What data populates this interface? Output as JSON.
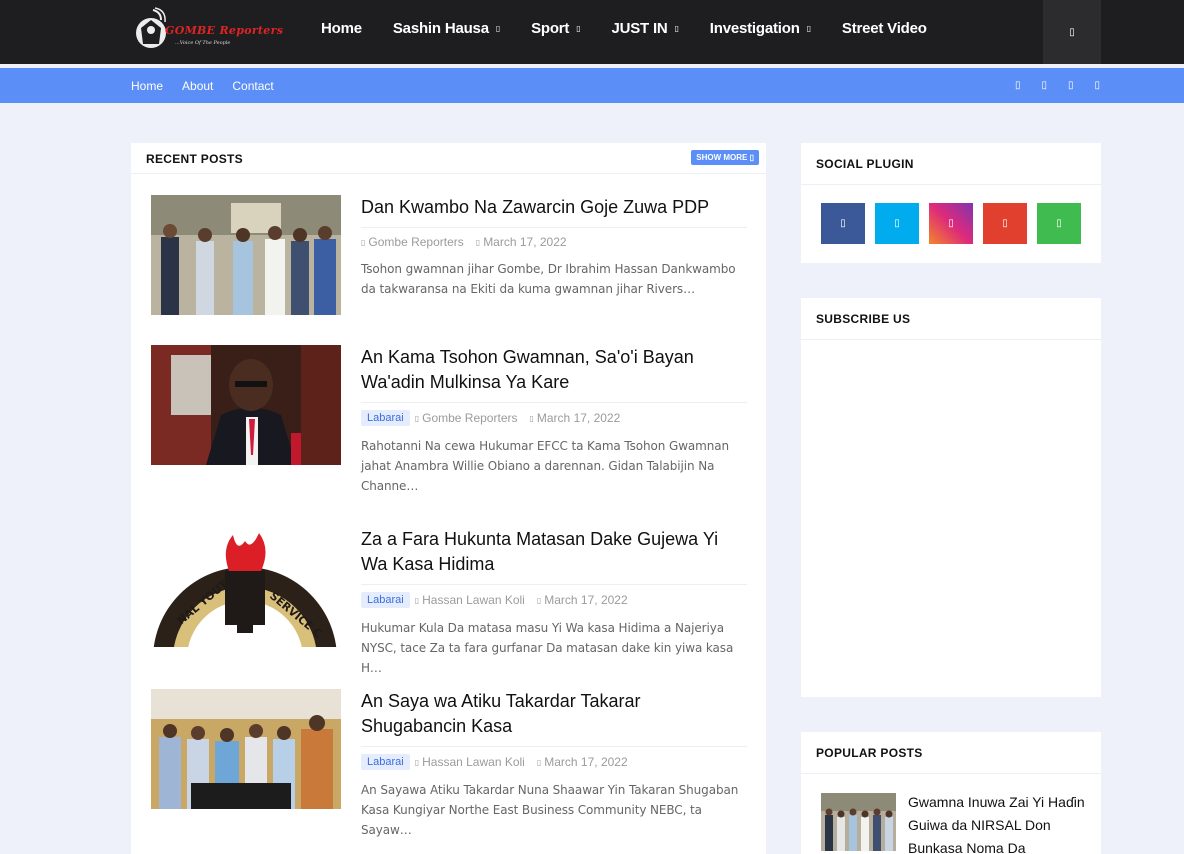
{
  "header": {
    "logo_text": "GOMBE Reporters",
    "logo_tagline": "...Voice Of The People",
    "nav": [
      {
        "label": "Home",
        "has_dropdown": false
      },
      {
        "label": "Sashin Hausa",
        "has_dropdown": true
      },
      {
        "label": "Sport",
        "has_dropdown": true
      },
      {
        "label": "JUST IN",
        "has_dropdown": true
      },
      {
        "label": "Investigation",
        "has_dropdown": true
      },
      {
        "label": "Street Video",
        "has_dropdown": false
      }
    ],
    "search_icon": "search-icon"
  },
  "subnav": {
    "links": [
      "Home",
      "About",
      "Contact"
    ],
    "social_icons": [
      "facebook-icon",
      "twitter-icon",
      "instagram-icon",
      "youtube-icon"
    ]
  },
  "recent_posts": {
    "title": "RECENT POSTS",
    "show_more": "SHOW MORE",
    "posts": [
      {
        "title": "Dan Kwambo Na Zawarcin Goje Zuwa PDP",
        "tag": "",
        "author": "Gombe Reporters",
        "date": "March 17, 2022",
        "excerpt": "Tsohon gwamnan jihar Gombe, Dr Ibrahim Hassan Dankwambo da takwaransa na Ekiti da kuma gwamnan jihar Rivers…"
      },
      {
        "title": "An Kama Tsohon Gwamnan, Sa'o'i Bayan Wa'adin Mulkinsa Ya Kare",
        "tag": "Labarai",
        "author": "Gombe Reporters",
        "date": "March 17, 2022",
        "excerpt": "Rahotanni Na cewa Hukumar EFCC ta Kama Tsohon Gwamnan jahat Anambra Willie Obiano a darennan. Gidan Talabijin Na Channe…"
      },
      {
        "title": "Za a Fara Hukunta Matasan Dake Gujewa Yi Wa Kasa Hidima",
        "tag": "Labarai",
        "author": "Hassan Lawan Koli",
        "date": "March 17, 2022",
        "excerpt": "Hukumar Kula Da matasa masu Yi Wa kasa Hidima a Najeriya NYSC, tace Za ta fara gurfanar Da matasan dake kin yiwa kasa H…"
      },
      {
        "title": "An Saya wa Atiku Takardar Takarar Shugabancin Kasa",
        "tag": "Labarai",
        "author": "Hassan Lawan Koli",
        "date": "March 17, 2022",
        "excerpt": "An Sayawa Atiku Takardar Nuna Shaawar Yin Takaran Shugaban Kasa Kungiyar Northe East Business Community NEBC, ta Sayaw…"
      }
    ]
  },
  "sidebar": {
    "social_plugin": {
      "title": "SOCIAL PLUGIN",
      "buttons": [
        {
          "icon": "facebook-icon",
          "color": "#3b5998"
        },
        {
          "icon": "twitter-icon",
          "color": "#00acee"
        },
        {
          "icon": "instagram-icon",
          "color": "#c13584"
        },
        {
          "icon": "youtube-icon",
          "color": "#e2402f"
        },
        {
          "icon": "whatsapp-icon",
          "color": "#3fbb50"
        }
      ]
    },
    "subscribe": {
      "title": "SUBSCRIBE US"
    },
    "popular_posts": {
      "title": "POPULAR POSTS",
      "first_post_title": "Gwamna Inuwa Zai Yi Haɗin Guiwa da NIRSAL Don Bunkasa Noma Da"
    }
  },
  "colors": {
    "header_bg": "#1e1e20",
    "accent_blue": "#5b8ef6",
    "page_bg": "#eef0fa"
  }
}
